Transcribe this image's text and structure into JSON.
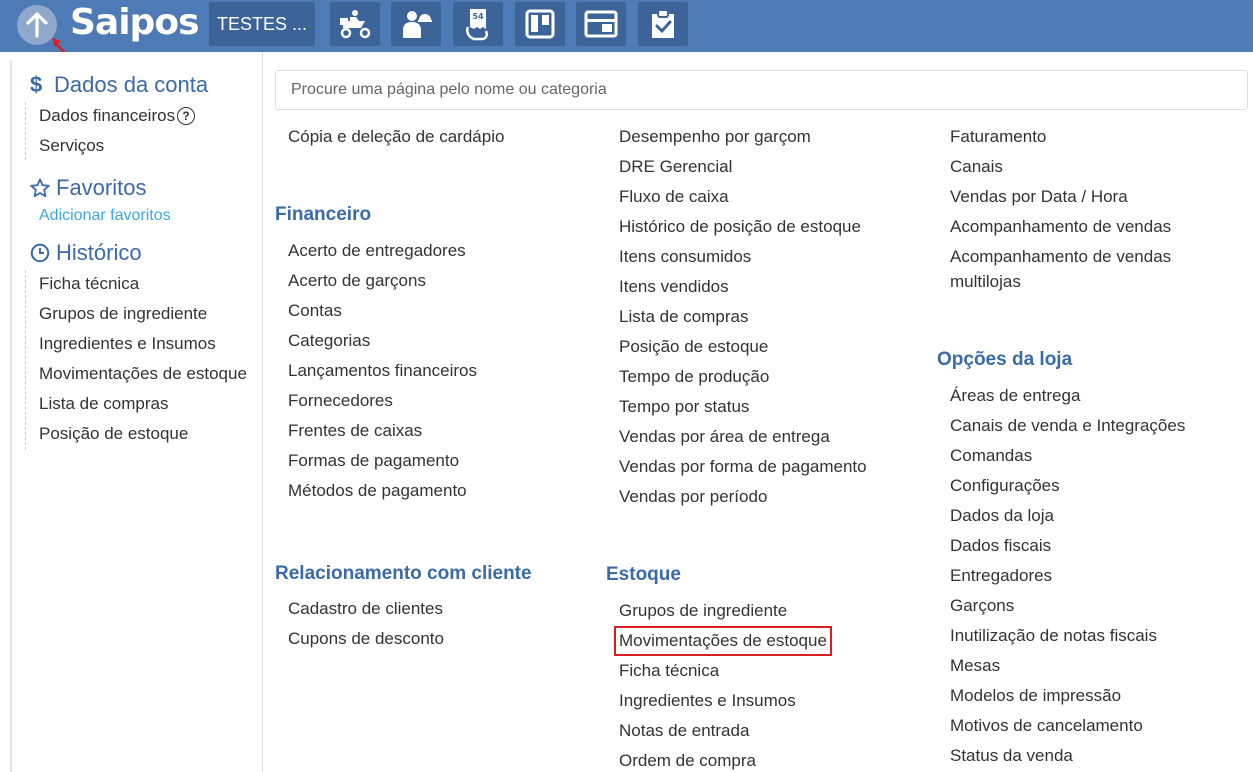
{
  "topbar": {
    "logo": "Saipos",
    "store_button": "TESTES ...",
    "tools": [
      "delivery-icon",
      "waiter-icon",
      "receipt-icon",
      "kanban-icon",
      "panel-icon",
      "checklist-icon"
    ]
  },
  "sidebar": {
    "account": {
      "title": "Dados da conta",
      "items": [
        "Dados financeiros",
        "Serviços"
      ]
    },
    "favorites": {
      "title": "Favoritos",
      "add_link": "Adicionar favoritos"
    },
    "history": {
      "title": "Histórico",
      "items": [
        "Ficha técnica",
        "Grupos de ingrediente",
        "Ingredientes e Insumos",
        "Movimentações de estoque",
        "Lista de compras",
        "Posição de estoque"
      ]
    }
  },
  "search": {
    "placeholder": "Procure uma página pelo nome ou categoria"
  },
  "col1": {
    "top_items": [
      "Cópia e deleção de cardápio"
    ],
    "financeiro": {
      "title": "Financeiro",
      "items": [
        "Acerto de entregadores",
        "Acerto de garçons",
        "Contas",
        "Categorias",
        "Lançamentos financeiros",
        "Fornecedores",
        "Frentes de caixas",
        "Formas de pagamento",
        "Métodos de pagamento"
      ]
    },
    "relacionamento": {
      "title": "Relacionamento com cliente",
      "items": [
        "Cadastro de clientes",
        "Cupons de desconto"
      ]
    }
  },
  "col2": {
    "top_items": [
      "Desempenho por garçom",
      "DRE Gerencial",
      "Fluxo de caixa",
      "Histórico de posição de estoque",
      "Itens consumidos",
      "Itens vendidos",
      "Lista de compras",
      "Posição de estoque",
      "Tempo de produção",
      "Tempo por status",
      "Vendas por área de entrega",
      "Vendas por forma de pagamento",
      "Vendas por período"
    ],
    "estoque": {
      "title": "Estoque",
      "items": [
        "Grupos de ingrediente",
        "Movimentações de estoque",
        "Ficha técnica",
        "Ingredientes e Insumos",
        "Notas de entrada",
        "Ordem de compra"
      ]
    }
  },
  "col3": {
    "top_items": [
      "Faturamento",
      "Canais",
      "Vendas por Data / Hora",
      "Acompanhamento de vendas",
      "Acompanhamento de vendas",
      "multilojas"
    ],
    "opcoes": {
      "title": "Opções da loja",
      "items": [
        "Áreas de entrega",
        "Canais de venda e Integrações",
        "Comandas",
        "Configurações",
        "Dados da loja",
        "Dados fiscais",
        "Entregadores",
        "Garçons",
        "Inutilização de notas fiscais",
        "Mesas",
        "Modelos de impressão",
        "Motivos de cancelamento",
        "Status da venda"
      ]
    }
  },
  "colors": {
    "topbar": "#4e7ab5",
    "section_heading": "#3b6aa8",
    "link": "#3fa7e0",
    "highlight": "#d81e1e"
  }
}
